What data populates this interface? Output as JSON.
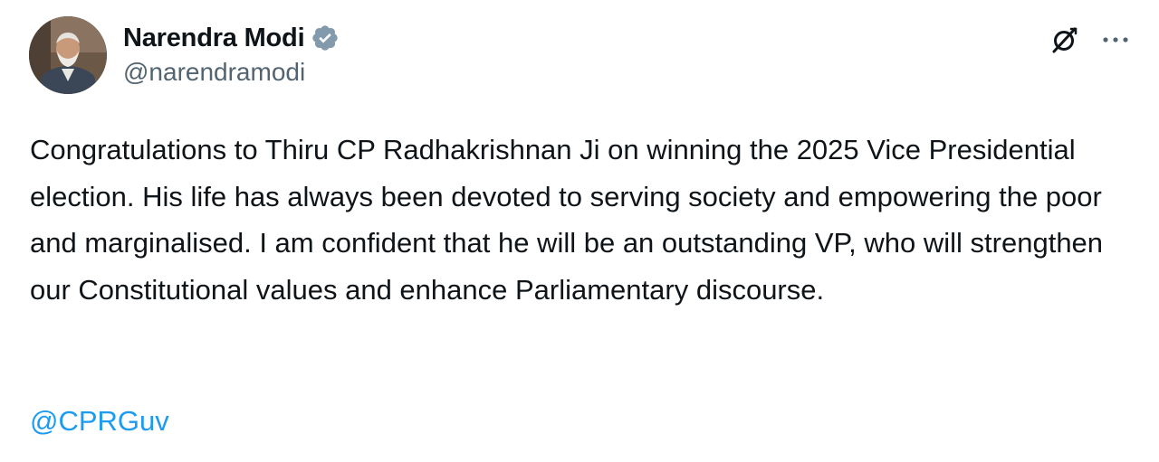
{
  "author": {
    "display_name": "Narendra Modi",
    "handle": "@narendramodi",
    "verified": true,
    "avatar_icon": "profile-photo"
  },
  "actions": {
    "grok_icon": "grok-icon",
    "more_icon": "more-options-icon"
  },
  "post": {
    "text": "Congratulations to Thiru CP Radhakrishnan Ji on winning the 2025 Vice Presidential election. His life has always been devoted to serving society and empowering the poor and marginalised. I am confident that he will be an outstanding VP, who will strengthen our Constitutional values and enhance Parliamentary discourse.",
    "mention": "@CPRGuv"
  },
  "colors": {
    "text": "#0f1419",
    "secondary": "#536471",
    "link": "#1d9bf0",
    "verified_badge": "#829aab"
  }
}
